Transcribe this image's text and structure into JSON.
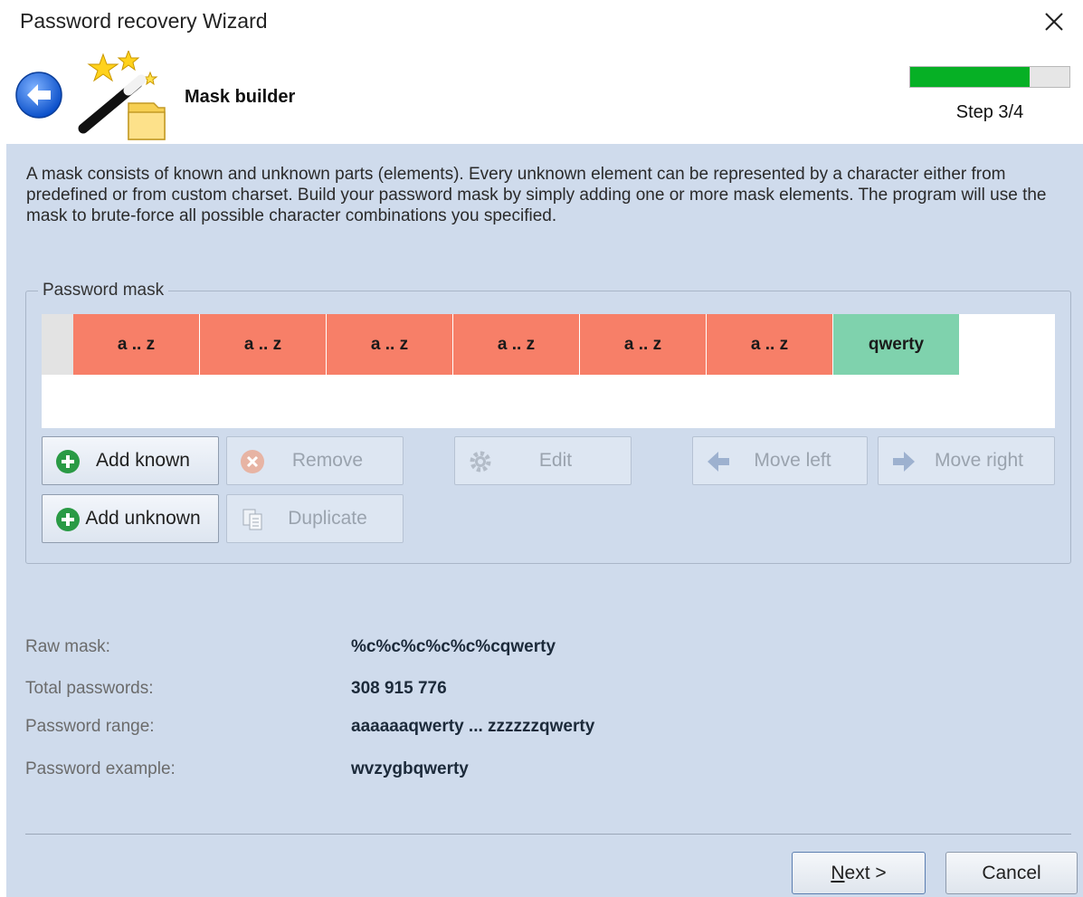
{
  "window": {
    "title": "Password recovery Wizard",
    "close_icon": "close-icon"
  },
  "header": {
    "title": "Mask builder",
    "back_icon": "back-arrow-icon",
    "wizard_icon": "magic-wand-folder-icon",
    "progress": {
      "value": 0.75,
      "fill_color": "#06b025"
    },
    "step_text": "Step 3/4"
  },
  "description": "A mask consists of known and unknown parts (elements). Every unknown element can be represented by a character either from predefined or from custom charset. Build your password mask by simply adding one or more mask elements. The program will use the mask to brute-force all possible character combinations you specified.",
  "password_mask": {
    "label": "Password mask",
    "elements": [
      {
        "text": "a .. z",
        "kind": "unknown",
        "color": "#f77f68"
      },
      {
        "text": "a .. z",
        "kind": "unknown",
        "color": "#f77f68"
      },
      {
        "text": "a .. z",
        "kind": "unknown",
        "color": "#f77f68"
      },
      {
        "text": "a .. z",
        "kind": "unknown",
        "color": "#f77f68"
      },
      {
        "text": "a .. z",
        "kind": "unknown",
        "color": "#f77f68"
      },
      {
        "text": "a .. z",
        "kind": "unknown",
        "color": "#f77f68"
      },
      {
        "text": "qwerty",
        "kind": "known",
        "color": "#7fd2ad"
      }
    ],
    "buttons": {
      "add_known": {
        "label": "Add known",
        "icon": "plus-circle-icon",
        "enabled": true
      },
      "add_unknown": {
        "label": "Add unknown",
        "icon": "plus-circle-icon",
        "enabled": true
      },
      "remove": {
        "label": "Remove",
        "icon": "remove-circle-icon",
        "enabled": false
      },
      "duplicate": {
        "label": "Duplicate",
        "icon": "copy-icon",
        "enabled": false
      },
      "edit": {
        "label": "Edit",
        "icon": "gear-icon",
        "enabled": false
      },
      "move_left": {
        "label": "Move left",
        "icon": "arrow-left-icon",
        "enabled": false
      },
      "move_right": {
        "label": "Move right",
        "icon": "arrow-right-icon",
        "enabled": false
      }
    }
  },
  "info": {
    "raw_mask_label": "Raw mask:",
    "raw_mask_value": "%c%c%c%c%c%cqwerty",
    "total_label": "Total passwords:",
    "total_value": "308 915 776",
    "range_label": "Password range:",
    "range_value": "aaaaaaqwerty ... zzzzzzqwerty",
    "example_label": "Password example:",
    "example_value": "wvzygbqwerty"
  },
  "footer": {
    "next_label": "Next >",
    "cancel_label": "Cancel"
  },
  "colors": {
    "panel_bg": "#cfdbec",
    "unknown_element": "#f77f68",
    "known_element": "#7fd2ad",
    "progress_green": "#06b025"
  }
}
